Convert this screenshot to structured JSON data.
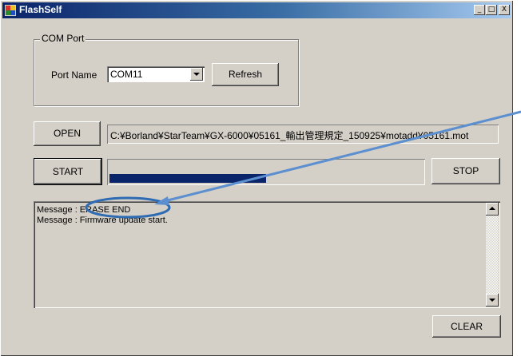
{
  "window": {
    "title": "FlashSelf",
    "minimize_glyph": "_",
    "maximize_glyph": "□",
    "close_glyph": "X"
  },
  "com_port": {
    "group_label": "COM Port",
    "port_name_label": "Port Name",
    "port_value": "COM11",
    "refresh_label": "Refresh"
  },
  "file": {
    "open_label": "OPEN",
    "path": "C:¥Borland¥StarTeam¥GX-6000¥05161_輸出管理規定_150925¥motadd¥05161.mot"
  },
  "progress": {
    "start_label": "START",
    "stop_label": "STOP",
    "value_fraction": 0.5
  },
  "messages": {
    "lines": [
      "Message : ERASE END",
      "Message : Firmware update start."
    ],
    "clear_label": "CLEAR"
  },
  "colors": {
    "titlebar_start": "#0a246a",
    "progress_fill": "#0a246a",
    "annotation_blue": "#2f6bb3",
    "arrow_blue": "#5b8fcf"
  },
  "icons": {
    "app": "flashself-app-icon",
    "dropdown": "chevron-down-icon",
    "scroll_up": "scroll-up-icon",
    "scroll_down": "scroll-down-icon"
  }
}
